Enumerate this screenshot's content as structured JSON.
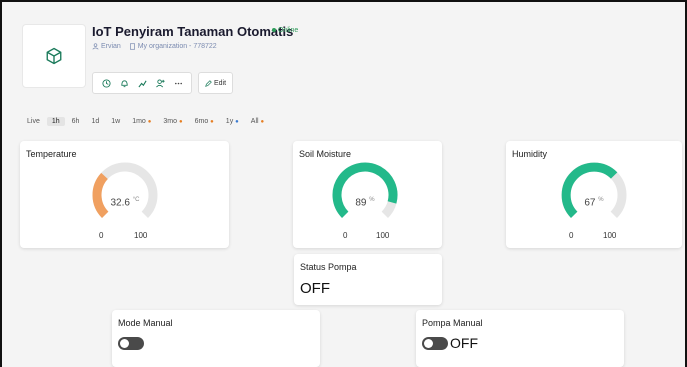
{
  "device": {
    "title": "IoT Penyiram Tanaman Otomatis",
    "status": "Online",
    "owner": "Ervian",
    "org": "My organization - 778722"
  },
  "toolbar": {
    "edit_label": "Edit"
  },
  "timerange": {
    "options": [
      "Live",
      "1h",
      "6h",
      "1d",
      "1w",
      "1mo",
      "3mo",
      "6mo",
      "1y",
      "All"
    ],
    "active": "1h"
  },
  "widgets": {
    "temperature": {
      "label": "Temperature",
      "value": "32.6",
      "unit": "°C",
      "min": "0",
      "max": "100",
      "level": 0.326,
      "color": "#f0a060"
    },
    "soil": {
      "label": "Soil Moisture",
      "value": "89",
      "unit": "%",
      "min": "0",
      "max": "100",
      "level": 0.89,
      "color": "#23b98a"
    },
    "humidity": {
      "label": "Humidity",
      "value": "67",
      "unit": "%",
      "min": "0",
      "max": "100",
      "level": 0.67,
      "color": "#23b98a"
    },
    "pump_status": {
      "label": "Status Pompa",
      "value": "OFF"
    },
    "manual_mode": {
      "label": "Mode Manual"
    },
    "manual_pump": {
      "label": "Pompa Manual",
      "value": "OFF"
    }
  },
  "icons": {
    "device": "cube-icon",
    "owner": "user-icon",
    "org": "building-icon",
    "toolbar": [
      "clock-icon",
      "bell-icon",
      "chart-icon",
      "user-add-icon",
      "more-icon"
    ]
  }
}
